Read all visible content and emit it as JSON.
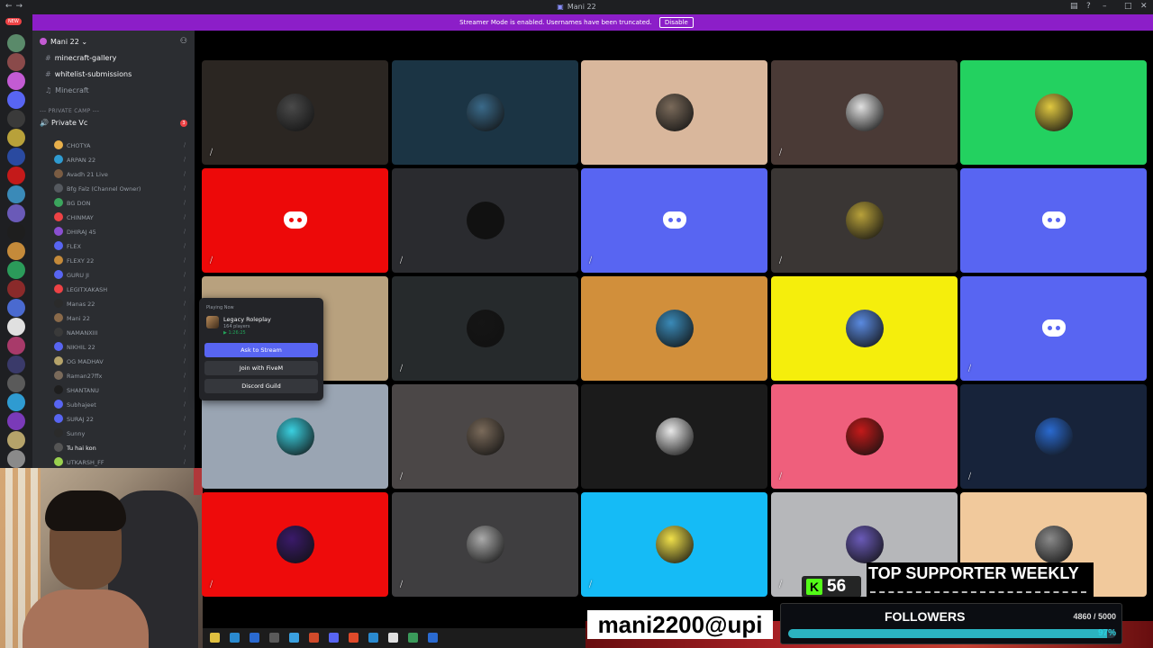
{
  "window": {
    "title": "Mani 22"
  },
  "banner": {
    "text": "Streamer Mode is enabled. Usernames have been truncated.",
    "disable_label": "Disable"
  },
  "rail": {
    "new_badge": "NEW"
  },
  "sidebar": {
    "server_name": "Mani 22",
    "channels": [
      {
        "name": "minecraft-gallery"
      },
      {
        "name": "whitelist-submissions"
      },
      {
        "name": "Minecraft"
      }
    ],
    "category": "PRIVATE CAMP",
    "voice_channel": {
      "name": "Private Vc",
      "badge": "3"
    },
    "members": [
      {
        "name": "CHOTYA",
        "color": "#e8b04b"
      },
      {
        "name": "ARPAN 22",
        "color": "#2f9bd1"
      },
      {
        "name": "Avadh 21 Live",
        "color": "#7a5c43"
      },
      {
        "name": "Bfg Falz (Channel Owner)",
        "color": "#55595f"
      },
      {
        "name": "BG DON",
        "color": "#3ba55d"
      },
      {
        "name": "CHINMAY",
        "color": "#ed4245"
      },
      {
        "name": "DHIRAJ 45",
        "color": "#8a4fd1"
      },
      {
        "name": "FLEX",
        "color": "#5865f2"
      },
      {
        "name": "FLEXY 22",
        "color": "#c48a3a"
      },
      {
        "name": "GURU JI",
        "color": "#5865f2"
      },
      {
        "name": "LEGITXAKASH",
        "color": "#ed4245"
      },
      {
        "name": "Manas 22",
        "color": "#2b2b2b"
      },
      {
        "name": "Mani 22",
        "color": "#8a6a4a"
      },
      {
        "name": "NAMANXIII",
        "color": "#3a3a3a"
      },
      {
        "name": "NIKHIL 22",
        "color": "#5865f2"
      },
      {
        "name": "OG MADHAV",
        "color": "#b5a36a"
      },
      {
        "name": "Raman27ffx",
        "color": "#7a6a5a"
      },
      {
        "name": "SHANTANU",
        "color": "#1e1e1e"
      },
      {
        "name": "Subhajeet",
        "color": "#5865f2"
      },
      {
        "name": "SURAJ 22",
        "color": "#5865f2"
      },
      {
        "name": "Sunny",
        "color": "#2b2b2b"
      },
      {
        "name": "Tu hai kon",
        "color": "#555555"
      },
      {
        "name": "UTKARSH_FF",
        "color": "#9ad14f"
      }
    ]
  },
  "popup": {
    "header": "Playing Now",
    "game": "Legacy Roleplay",
    "players": "164 players",
    "elapsed": "1:26:25",
    "buttons": [
      "Ask to Stream",
      "Join with FiveM",
      "Discord Guild"
    ]
  },
  "grid": [
    {
      "bg": "#2b2622",
      "kind": "avatar",
      "av": "#4a4a4a",
      "muted": true
    },
    {
      "bg": "#1b3444",
      "kind": "avatar",
      "av": "#3a6a8a",
      "muted": false
    },
    {
      "bg": "#d9b79c",
      "kind": "avatar",
      "av": "#7a6a5a",
      "muted": false
    },
    {
      "bg": "#4a3a36",
      "kind": "avatar",
      "av": "#e0e0e0",
      "muted": true
    },
    {
      "bg": "#23d160",
      "kind": "avatar",
      "av": "#e0c840",
      "muted": false
    },
    {
      "bg": "#ed0909",
      "kind": "discord",
      "av": "#ffffff",
      "muted": true
    },
    {
      "bg": "#2a2b2f",
      "kind": "avatar",
      "av": "#111111",
      "muted": true
    },
    {
      "bg": "#5865f2",
      "kind": "discord",
      "av": "#ffffff",
      "muted": true
    },
    {
      "bg": "#3a3634",
      "kind": "avatar",
      "av": "#b8a13a",
      "muted": true
    },
    {
      "bg": "#5865f2",
      "kind": "discord",
      "av": "#ffffff",
      "muted": false
    },
    {
      "bg": "#b8a17e",
      "kind": "avatar",
      "av": "#8a7050",
      "muted": false
    },
    {
      "bg": "#262a2c",
      "kind": "avatar",
      "av": "#151515",
      "muted": true
    },
    {
      "bg": "#d18f3b",
      "kind": "avatar",
      "av": "#3a8ab8",
      "muted": false
    },
    {
      "bg": "#f5ee0c",
      "kind": "avatar",
      "av": "#5a8ae0",
      "muted": false
    },
    {
      "bg": "#5865f2",
      "kind": "discord",
      "av": "#ffffff",
      "muted": true
    },
    {
      "bg": "#9aa5b3",
      "kind": "avatar",
      "av": "#3ad0e0",
      "muted": false
    },
    {
      "bg": "#4b4747",
      "kind": "avatar",
      "av": "#7a6a5a",
      "muted": true
    },
    {
      "bg": "#1b1b1b",
      "kind": "avatar",
      "av": "#e8e8e8",
      "muted": false
    },
    {
      "bg": "#ef5f7c",
      "kind": "avatar",
      "av": "#c41a1a",
      "muted": true
    },
    {
      "bg": "#17233a",
      "kind": "avatar",
      "av": "#2a6ad0",
      "muted": true
    },
    {
      "bg": "#ee0b0b",
      "kind": "avatar",
      "av": "#3a1a6a",
      "muted": true
    },
    {
      "bg": "#3f3e40",
      "kind": "avatar",
      "av": "#aaaaaa",
      "muted": true
    },
    {
      "bg": "#15bbf6",
      "kind": "avatar",
      "av": "#f0e04a",
      "muted": true
    },
    {
      "bg": "#b6b7ba",
      "kind": "avatar",
      "av": "#6a5ab8",
      "muted": true
    },
    {
      "bg": "#f1c99c",
      "kind": "avatar",
      "av": "#8a8a8a",
      "muted": false
    }
  ],
  "overlay": {
    "top_supporter": "TOP SUPPORTER WEEKLY",
    "kick_count": "56",
    "upi": "mani2200@upi",
    "followers_label": "FOLLOWERS",
    "followers_count": "4860 / 5000",
    "followers_pct": "97%",
    "followers_progress": 0.972
  }
}
